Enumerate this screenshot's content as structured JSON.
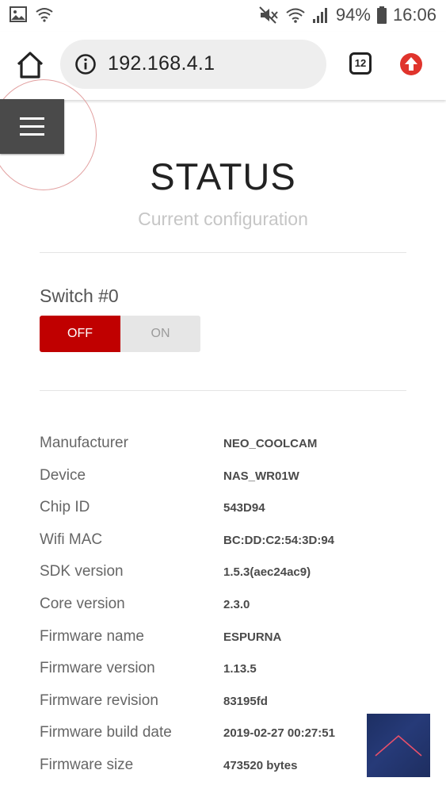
{
  "status_bar": {
    "icons_left": [
      "image-notification-icon",
      "wifi-notification-icon"
    ],
    "icons_right": [
      "mute-icon",
      "wifi-icon",
      "signal-icon"
    ],
    "battery": "94%",
    "time": "16:06"
  },
  "browser": {
    "url": "192.168.4.1",
    "tab_count": "12"
  },
  "page": {
    "title": "STATUS",
    "subtitle": "Current configuration"
  },
  "switch": {
    "label": "Switch #0",
    "off_label": "OFF",
    "on_label": "ON",
    "state": "off"
  },
  "info": [
    {
      "label": "Manufacturer",
      "value": "NEO_COOLCAM"
    },
    {
      "label": "Device",
      "value": "NAS_WR01W"
    },
    {
      "label": "Chip ID",
      "value": "543D94"
    },
    {
      "label": "Wifi MAC",
      "value": "BC:DD:C2:54:3D:94"
    },
    {
      "label": "SDK version",
      "value": "1.5.3(aec24ac9)"
    },
    {
      "label": "Core version",
      "value": "2.3.0"
    },
    {
      "label": "Firmware name",
      "value": "ESPURNA"
    },
    {
      "label": "Firmware version",
      "value": "1.13.5"
    },
    {
      "label": "Firmware revision",
      "value": "83195fd"
    },
    {
      "label": "Firmware build date",
      "value": "2019-02-27 00:27:51"
    },
    {
      "label": "Firmware size",
      "value": "473520 bytes"
    }
  ],
  "colors": {
    "accent": "#c00000",
    "menu_button": "#4a4a4a",
    "scroll_button": "#22356d"
  }
}
